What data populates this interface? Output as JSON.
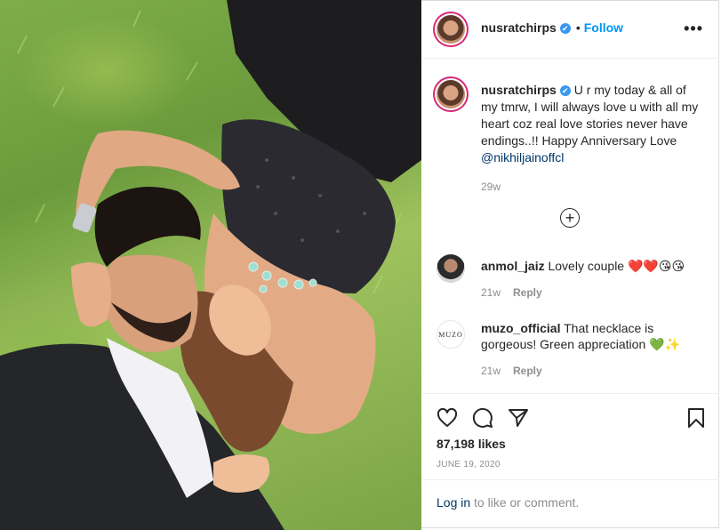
{
  "post": {
    "username": "nusratchirps",
    "verified_glyph": "✔",
    "dot": "•",
    "follow_label": "Follow",
    "more_label": "•••",
    "photo_alt": "couple lying on grass"
  },
  "caption": {
    "username": "nusratchirps",
    "text": "U r my today & all of my tmrw, I will always love u with all my heart coz real love stories never have endings..!! Happy Anniversary Love ",
    "mention": "@nikhiljainoffcl",
    "age": "29w",
    "load_more_glyph": "+"
  },
  "comments": [
    {
      "username": "anmol_jaiz",
      "text": "Lovely couple ",
      "emojis": "❤️❤️😘😘",
      "age": "21w",
      "reply_label": "Reply"
    },
    {
      "username": "muzo_official",
      "avatar_text": "MUZO",
      "text": "That necklace is gorgeous! Green appreciation ",
      "emojis": "💚✨",
      "age": "21w",
      "reply_label": "Reply"
    }
  ],
  "actions": {
    "likes": "87,198 likes",
    "date": "JUNE 19, 2020",
    "login_link": "Log in",
    "login_suffix": " to like or comment."
  },
  "colors": {
    "accent_blue": "#0095f6",
    "verified_blue": "#3897f0",
    "story_ring": "#d62976",
    "muted": "#8e8e8e"
  }
}
